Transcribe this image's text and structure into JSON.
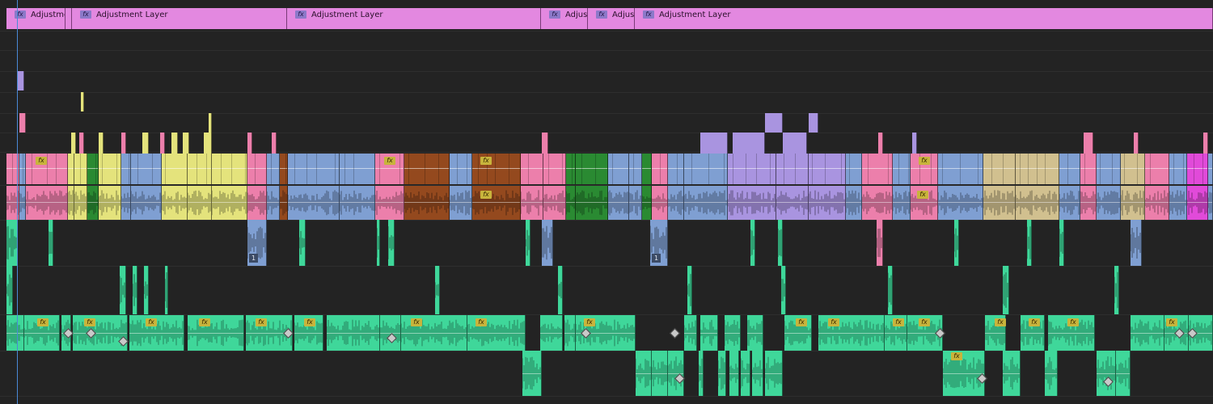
{
  "adjustment_clips": [
    {
      "label": "Adjustme",
      "fx": "fx"
    },
    {
      "label": "",
      "fx": ""
    },
    {
      "label": "Adjustment Layer",
      "fx": "fx"
    },
    {
      "label": "Adjustment Layer",
      "fx": "fx"
    },
    {
      "label": "Adjus",
      "fx": "fx"
    },
    {
      "label": "Adjus",
      "fx": "fx"
    },
    {
      "label": "Adjustment Layer",
      "fx": "fx"
    }
  ],
  "fx_label": "fx",
  "clip_badge": "1",
  "colors": {
    "background": "#232323",
    "adjustment": "#e388e0",
    "pink": "#ec7fab",
    "yellow": "#e4e37c",
    "blue": "#7f9fd2",
    "brown": "#94491e",
    "purple": "#a994e0",
    "tan": "#d1c08f",
    "magenta": "#e14ad9",
    "dark_green": "#2a8a32",
    "green": "#1eba6e",
    "audio_green": "#3fd79a",
    "playhead": "#4a8ad6"
  }
}
